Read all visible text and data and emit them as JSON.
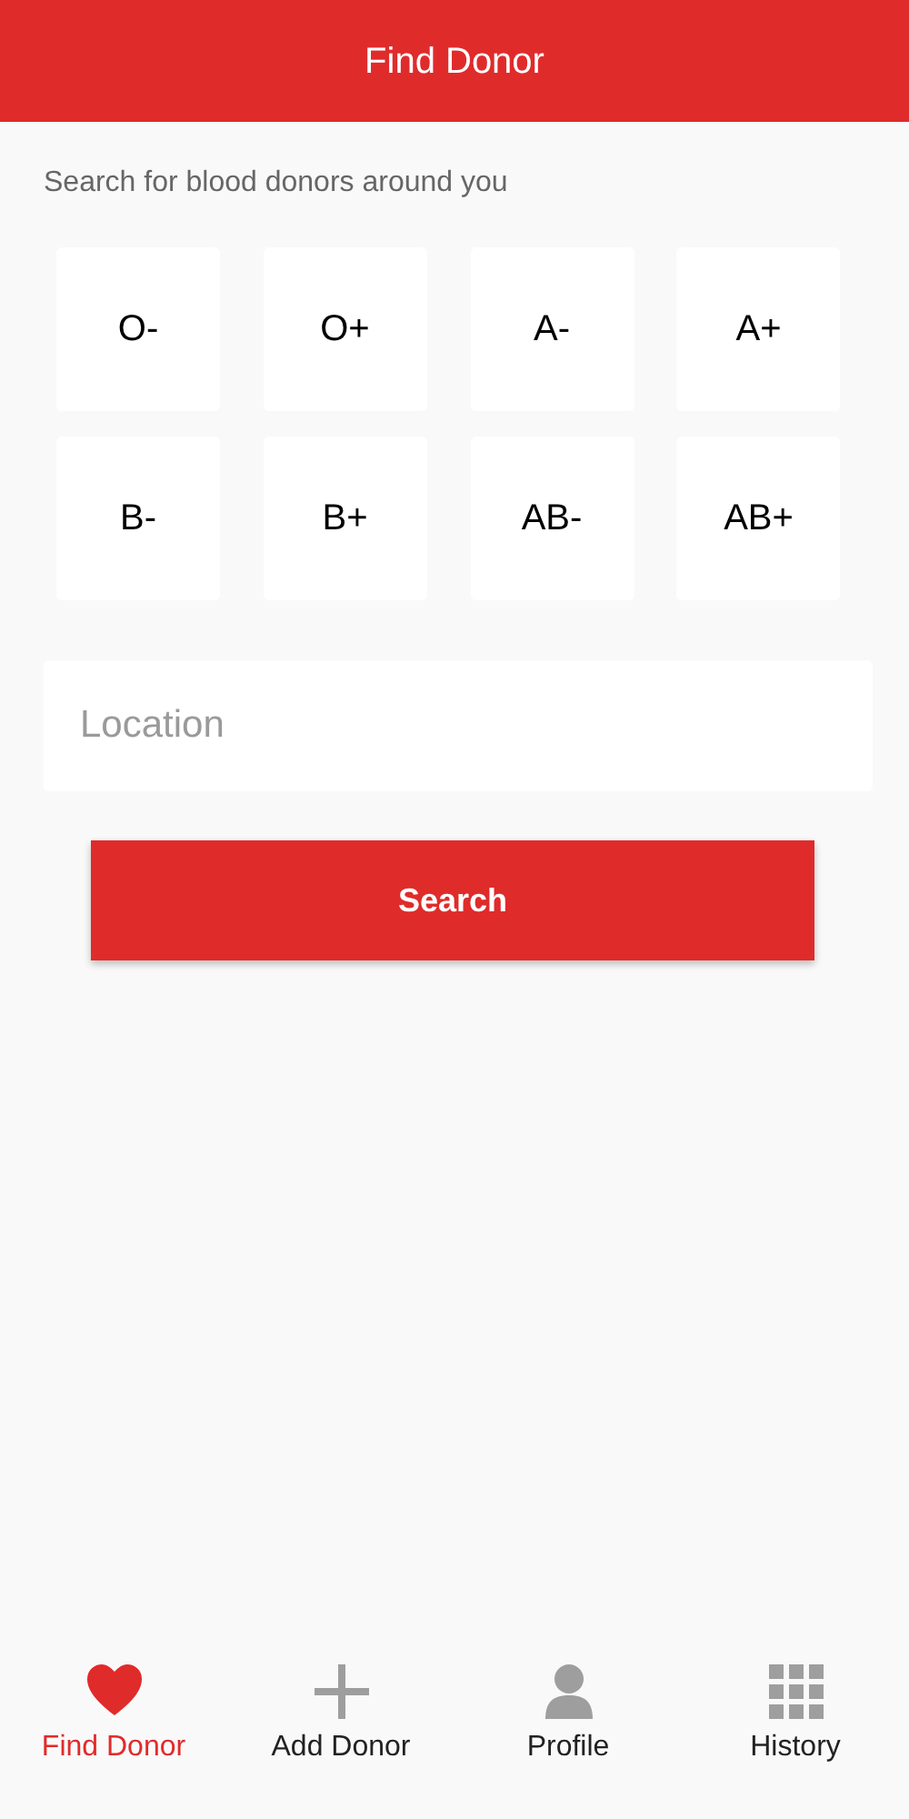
{
  "header": {
    "title": "Find Donor"
  },
  "subtitle": "Search for blood donors around you",
  "blood_types": [
    {
      "label": "O-",
      "selected": false
    },
    {
      "label": "O+",
      "selected": false
    },
    {
      "label": "A-",
      "selected": false
    },
    {
      "label": "A+",
      "selected": false
    },
    {
      "label": "B-",
      "selected": false
    },
    {
      "label": "B+",
      "selected": false
    },
    {
      "label": "AB-",
      "selected": false
    },
    {
      "label": "AB+",
      "selected": false
    }
  ],
  "location": {
    "placeholder": "Location"
  },
  "search_button": "Search",
  "nav": [
    {
      "label": "Find Donor",
      "selected": true
    },
    {
      "label": "Add Donor",
      "selected": false
    },
    {
      "label": "Profile",
      "selected": false
    },
    {
      "label": "History",
      "selected": false
    }
  ]
}
